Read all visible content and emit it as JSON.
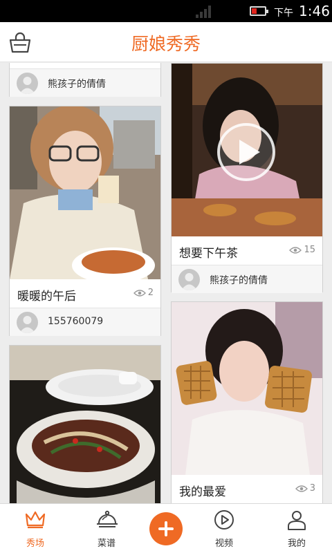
{
  "status_bar": {
    "period": "下午",
    "time": "1:46"
  },
  "header": {
    "title": "厨娘秀秀",
    "cart_icon": "shopping-bag-icon"
  },
  "feed": {
    "top_partial": {
      "user": "熊孩子的倩倩"
    },
    "left": [
      {
        "title": "暖暖的午后",
        "views": "2",
        "user": "155760079"
      },
      {
        "title": "",
        "views": "",
        "user": ""
      }
    ],
    "right": [
      {
        "title": "想要下午茶",
        "views": "15",
        "user": "熊孩子的倩倩",
        "is_video": true
      },
      {
        "title": "我的最爱",
        "views": "3",
        "user": ""
      }
    ]
  },
  "bottom_nav": {
    "items": [
      {
        "label": "秀场",
        "icon": "crown-icon",
        "active": true
      },
      {
        "label": "菜谱",
        "icon": "food-cloche-icon"
      },
      {
        "label": "",
        "icon": "plus-icon"
      },
      {
        "label": "视频",
        "icon": "play-circle-icon"
      },
      {
        "label": "我的",
        "icon": "person-icon"
      }
    ]
  },
  "colors": {
    "accent": "#ef6a24",
    "background": "#ededed"
  }
}
